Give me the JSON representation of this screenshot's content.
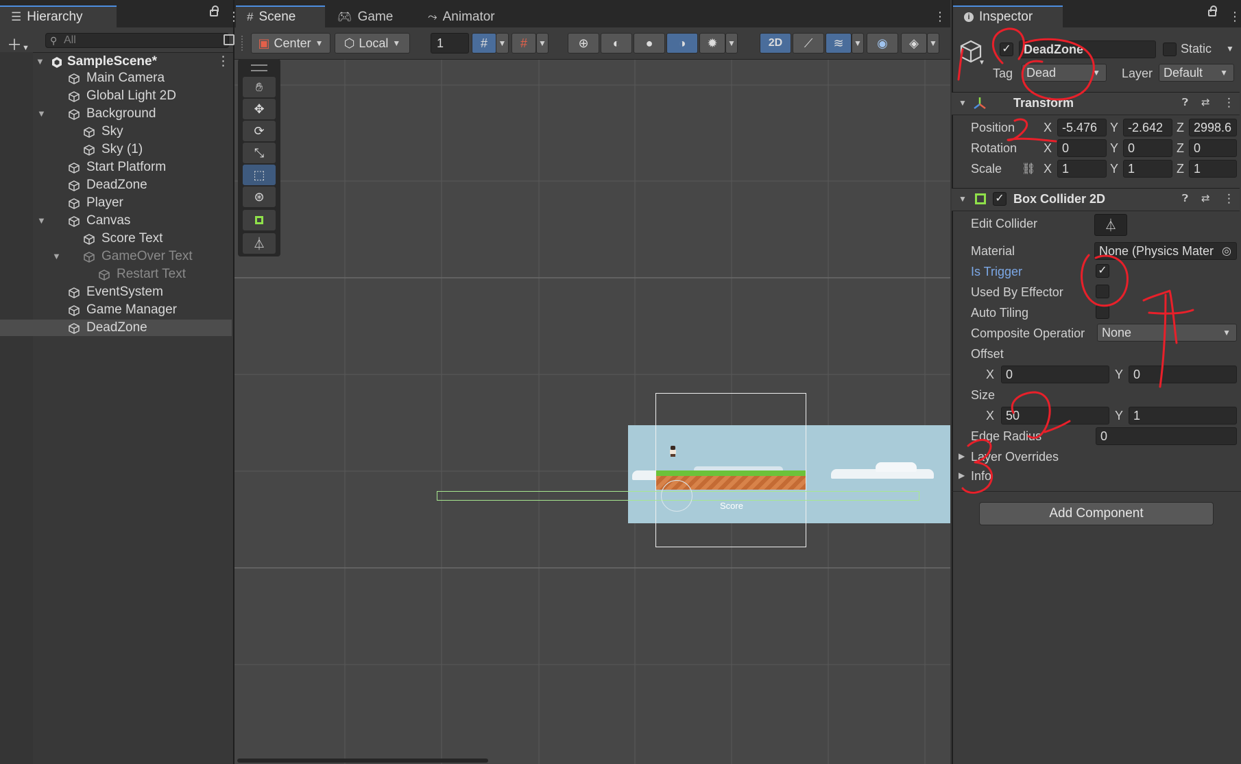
{
  "hierarchy": {
    "tab_label": "Hierarchy",
    "search_placeholder": "All",
    "scene_name": "SampleScene*",
    "items": [
      {
        "label": "Main Camera"
      },
      {
        "label": "Global Light 2D"
      },
      {
        "label": "Background"
      },
      {
        "label": "Sky"
      },
      {
        "label": "Sky (1)"
      },
      {
        "label": "Start Platform"
      },
      {
        "label": "DeadZone"
      },
      {
        "label": "Player"
      },
      {
        "label": "Canvas"
      },
      {
        "label": "Score Text"
      },
      {
        "label": "GameOver Text"
      },
      {
        "label": "Restart Text"
      },
      {
        "label": "EventSystem"
      },
      {
        "label": "Game Manager"
      },
      {
        "label": "DeadZone"
      }
    ]
  },
  "scene": {
    "tabs": [
      "Scene",
      "Game",
      "Animator"
    ],
    "toolbar": {
      "pivot": "Center",
      "space": "Local",
      "snap_value": "1",
      "mode_2d": "2D"
    },
    "score_label": "Score"
  },
  "inspector": {
    "tab_label": "Inspector",
    "object_name": "DeadZone",
    "static_label": "Static",
    "tag_label": "Tag",
    "tag_value": "Dead",
    "layer_label": "Layer",
    "layer_value": "Default",
    "transform": {
      "title": "Transform",
      "position_label": "Position",
      "rotation_label": "Rotation",
      "scale_label": "Scale",
      "position": {
        "x": "-5.476",
        "y": "-2.642",
        "z": "2998.6"
      },
      "rotation": {
        "x": "0",
        "y": "0",
        "z": "0"
      },
      "scale": {
        "x": "1",
        "y": "1",
        "z": "1"
      }
    },
    "box_collider": {
      "title": "Box Collider 2D",
      "edit_collider_label": "Edit Collider",
      "material_label": "Material",
      "material_value": "None (Physics Mater",
      "is_trigger_label": "Is Trigger",
      "used_by_effector_label": "Used By Effector",
      "auto_tiling_label": "Auto Tiling",
      "composite_label": "Composite Operatior",
      "composite_value": "None",
      "offset_label": "Offset",
      "offset": {
        "x": "0",
        "y": "0"
      },
      "size_label": "Size",
      "size": {
        "x": "50",
        "y": "1"
      },
      "edge_radius_label": "Edge Radius",
      "edge_radius": "0",
      "layer_overrides_label": "Layer Overrides",
      "info_label": "Info"
    },
    "add_component_label": "Add Component"
  },
  "axis_letters": {
    "x": "X",
    "y": "Y",
    "z": "Z"
  },
  "annotations": [
    "1",
    "2",
    "3",
    "4"
  ],
  "colors": {
    "accent": "#4d8ee0",
    "annotation": "#e8202a",
    "collider": "#a8e890",
    "sky": "#a9cbd8"
  }
}
